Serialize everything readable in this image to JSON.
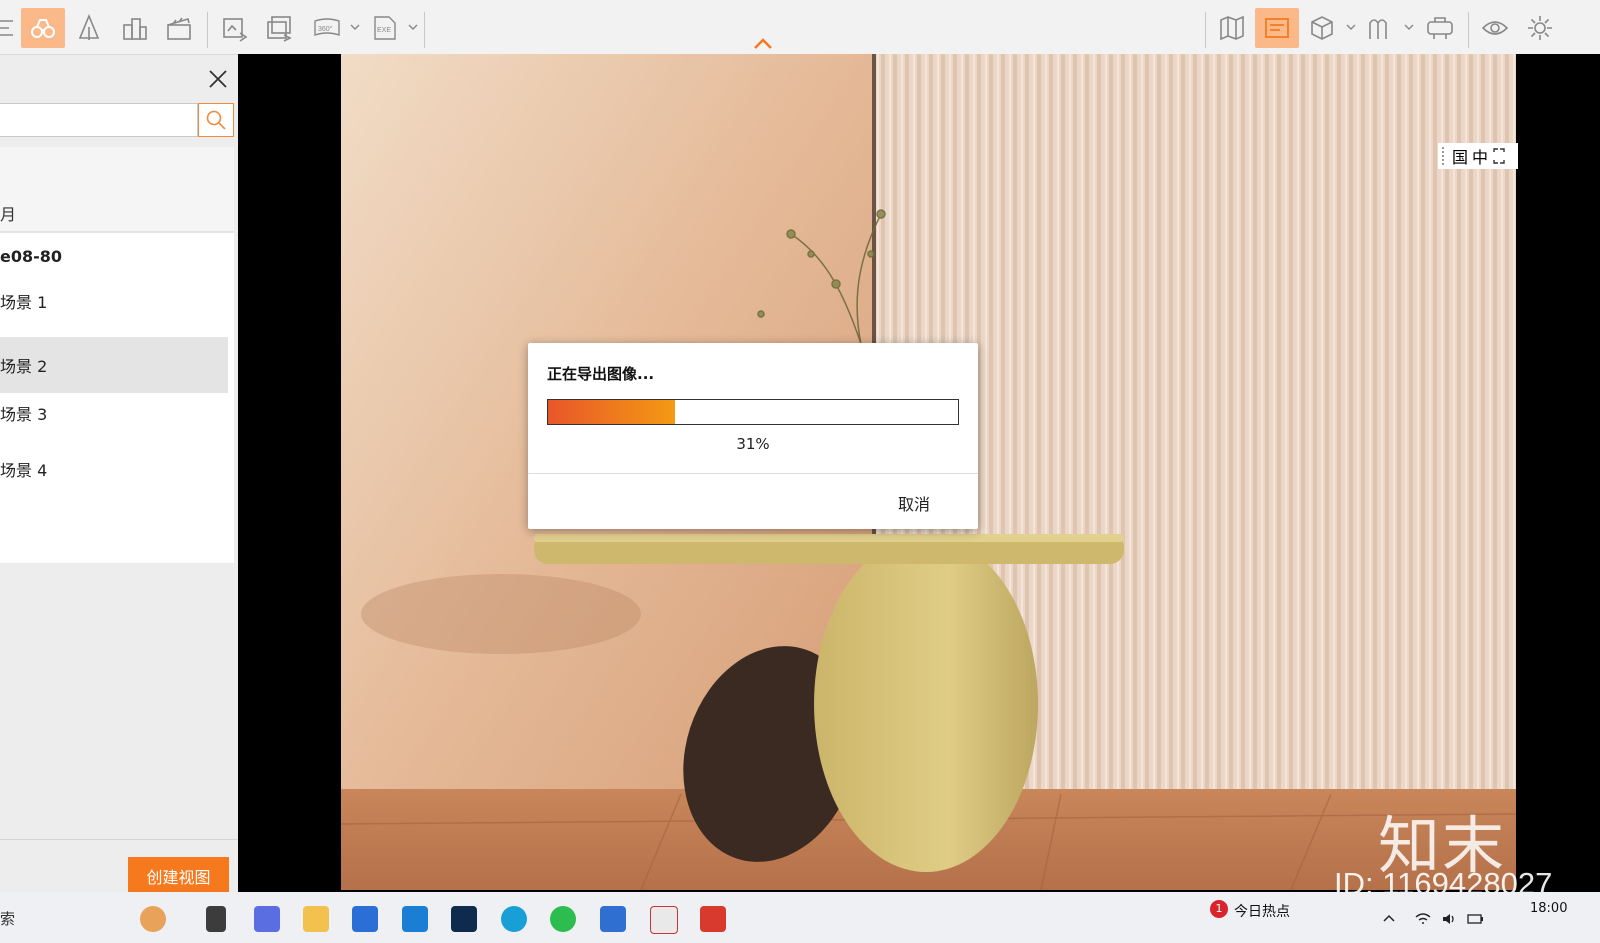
{
  "toolbar": {
    "tools": [
      {
        "name": "list-view",
        "icon": "list-icon"
      },
      {
        "name": "walkthrough",
        "icon": "binoculars-icon",
        "active": true
      },
      {
        "name": "landscape",
        "icon": "tree-icon"
      },
      {
        "name": "buildings",
        "icon": "buildings-icon"
      },
      {
        "name": "animation",
        "icon": "clapperboard-icon"
      },
      {
        "name": "export-image",
        "icon": "export-image-icon"
      },
      {
        "name": "batch-export",
        "icon": "batch-export-icon"
      },
      {
        "name": "export-360",
        "icon": "panorama-360-icon",
        "label": "360°"
      },
      {
        "name": "export-exe",
        "icon": "exe-icon",
        "label": "EXE"
      },
      {
        "name": "map",
        "icon": "map-icon"
      },
      {
        "name": "render-settings",
        "icon": "render-settings-icon",
        "active": true
      },
      {
        "name": "objects",
        "icon": "cube-icon"
      },
      {
        "name": "materials",
        "icon": "material-library-icon"
      },
      {
        "name": "vr",
        "icon": "vr-headset-icon"
      },
      {
        "name": "preview",
        "icon": "eye-icon"
      },
      {
        "name": "settings",
        "icon": "gear-icon"
      }
    ],
    "accent_color": "#f6791d"
  },
  "left_panel": {
    "tab_label": "月",
    "model_name": "e08-80",
    "scenes": [
      {
        "label": "场景 1",
        "selected": false
      },
      {
        "label": "场景 2",
        "selected": true
      },
      {
        "label": "场景 3",
        "selected": false
      },
      {
        "label": "场景 4",
        "selected": false
      }
    ],
    "create_view_label": "创建视图"
  },
  "view_controls": {
    "label_1": "国",
    "label_2": "中"
  },
  "watermark": {
    "brand": "知末",
    "id": "ID: 1169428027"
  },
  "dialog": {
    "title": "正在导出图像...",
    "progress_percent": 31,
    "progress_label": "31%",
    "cancel_label": "取消"
  },
  "taskbar": {
    "search_text": "索",
    "news_badge": "1",
    "news_label": "今日热点",
    "time": "18:00"
  }
}
